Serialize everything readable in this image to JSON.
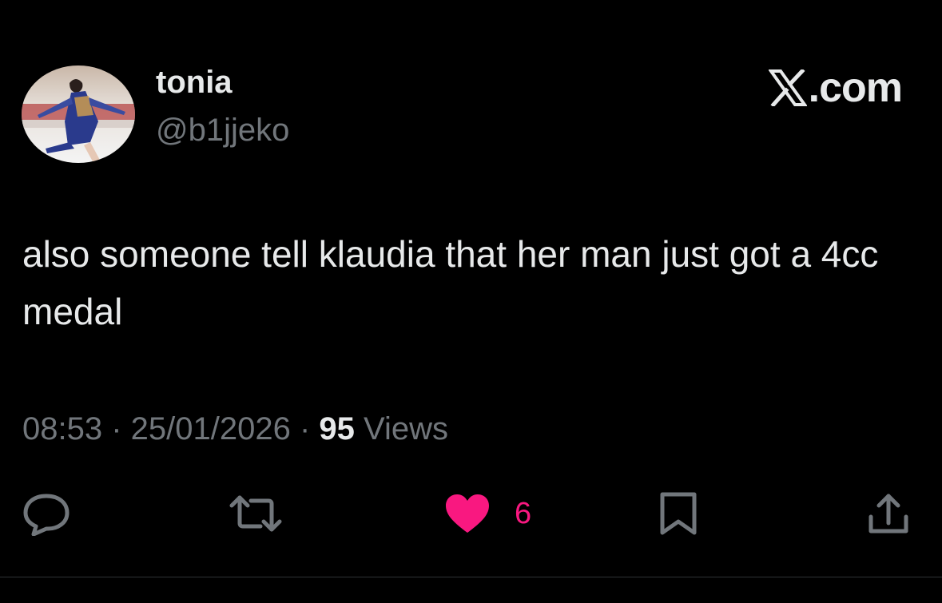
{
  "author": {
    "display_name": "tonia",
    "handle": "@b1jjeko"
  },
  "brand": {
    "text": ".com",
    "logo_icon": "x-logo-icon"
  },
  "tweet": {
    "text": "also someone tell klaudia that her man just got a 4cc medal"
  },
  "meta": {
    "time": "08:53",
    "separator": " · ",
    "date": "25/01/2026",
    "views_count": "95",
    "views_label": "Views"
  },
  "actions": {
    "reply_icon": "reply-icon",
    "retweet_icon": "retweet-icon",
    "like_icon": "heart-icon",
    "like_count": "6",
    "bookmark_icon": "bookmark-icon",
    "share_icon": "share-icon"
  },
  "colors": {
    "background": "#000000",
    "primary_text": "#e7e9ea",
    "secondary_text": "#71767b",
    "like_pink": "#f91880"
  }
}
